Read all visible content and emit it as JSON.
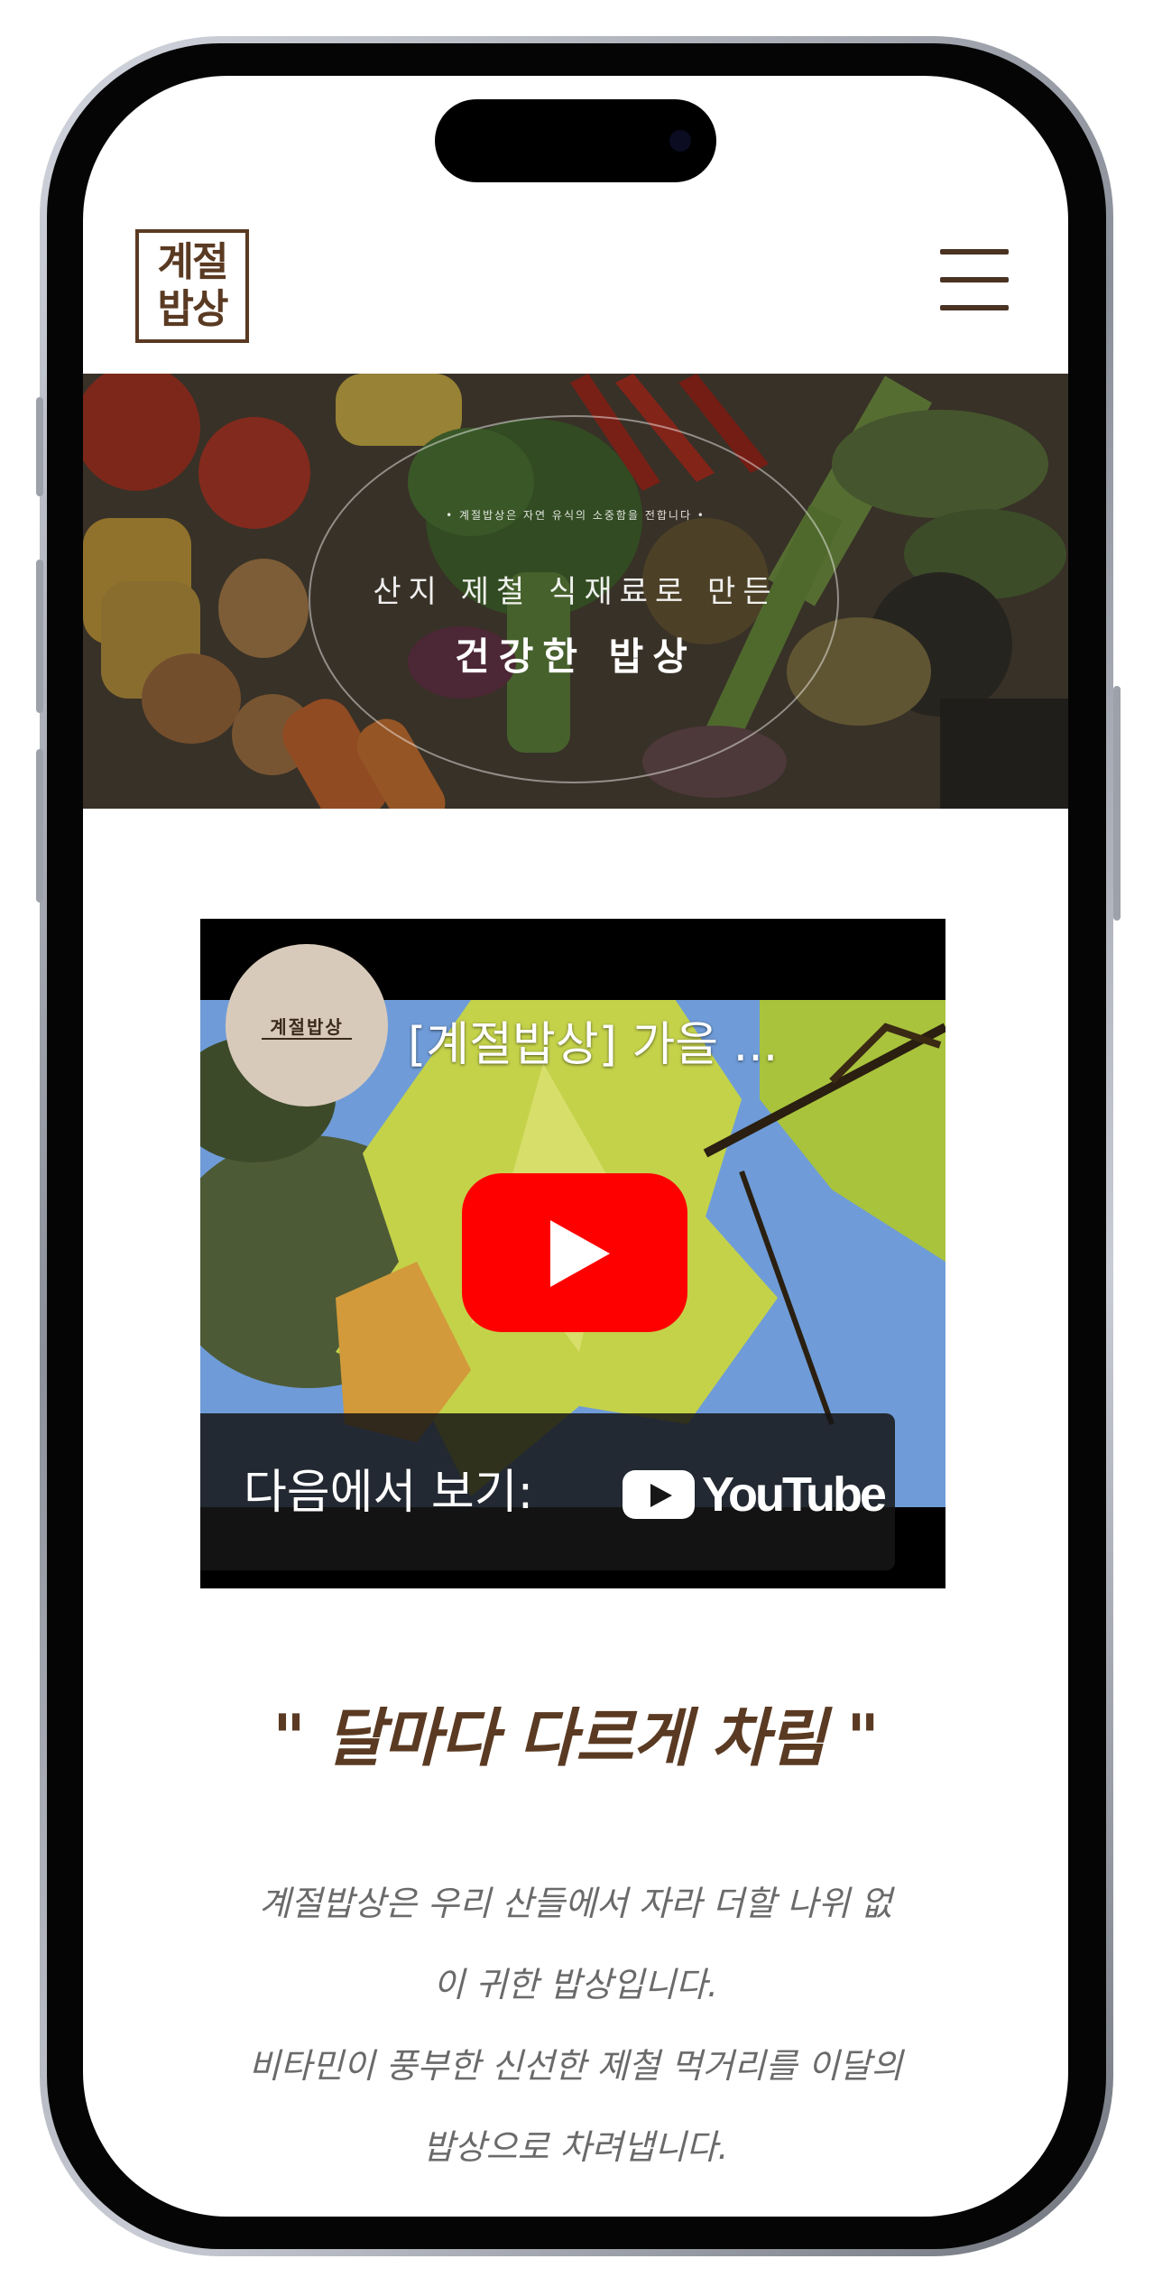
{
  "header": {
    "logo_line1": "계절",
    "logo_line2": "밥상"
  },
  "hero": {
    "small_text": "• 계절밥상은 자연 유식의 소중함을 전합니다 •",
    "line1": "산지 제철 식재료로 만든",
    "line2": "건강한 밥상"
  },
  "video": {
    "channel_name": "계절밥상",
    "title": "[계절밥상] 가을 ...",
    "watch_on_label": "다음에서 보기:",
    "platform": "YouTube"
  },
  "content": {
    "headline": "\" 달마다 다르게 차림 \"",
    "body_lines": [
      "계절밥상은 우리 산들에서 자라 더할 나위 없",
      "이 귀한 밥상입니다.",
      "비타민이 풍부한 신선한 제철 먹거리를 이달의",
      "밥상으로 차려냅니다."
    ]
  },
  "colors": {
    "brand_brown": "#5a3a22",
    "body_gray": "#6a6a6a",
    "youtube_red": "#ff0000"
  },
  "icons": [
    "hamburger-menu-icon",
    "youtube-play-icon",
    "youtube-logo-icon"
  ]
}
